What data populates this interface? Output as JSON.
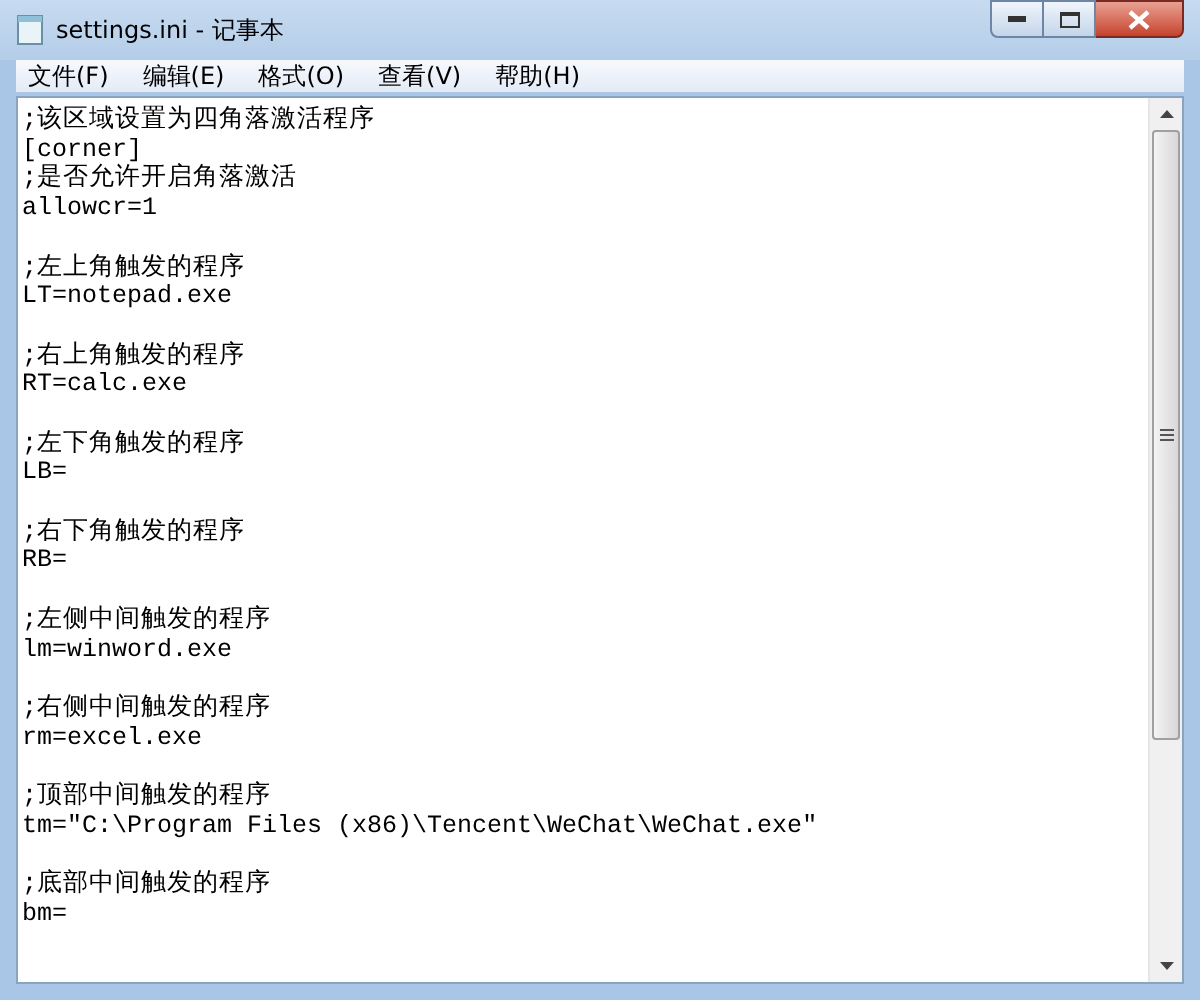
{
  "window": {
    "title": "settings.ini - 记事本"
  },
  "menu": [
    "文件(F)",
    "编辑(E)",
    "格式(O)",
    "查看(V)",
    "帮助(H)"
  ],
  "document": {
    "blocks": [
      [
        ";该区域设置为四角落激活程序",
        "[corner]",
        ";是否允许开启角落激活",
        "allowcr=1"
      ],
      [
        ";左上角触发的程序",
        "LT=notepad.exe"
      ],
      [
        ";右上角触发的程序",
        "RT=calc.exe"
      ],
      [
        ";左下角触发的程序",
        "LB="
      ],
      [
        ";右下角触发的程序",
        "RB="
      ],
      [
        ";左侧中间触发的程序",
        "lm=winword.exe"
      ],
      [
        ";右侧中间触发的程序",
        "rm=excel.exe"
      ],
      [
        ";顶部中间触发的程序",
        "tm=\"C:\\Program Files (x86)\\Tencent\\WeChat\\WeChat.exe\""
      ],
      [
        ";底部中间触发的程序",
        "bm="
      ]
    ]
  }
}
